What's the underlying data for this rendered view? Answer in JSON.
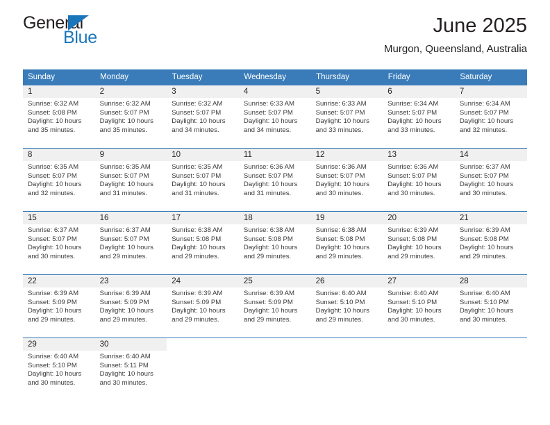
{
  "brand": {
    "name_part1": "General",
    "name_part2": "Blue",
    "accent_color": "#1b75bb"
  },
  "header": {
    "title": "June 2025",
    "subtitle": "Murgon, Queensland, Australia"
  },
  "calendar": {
    "header_bg": "#3a7cb9",
    "daynum_bg": "#f0f0f0",
    "weekday_headers": [
      "Sunday",
      "Monday",
      "Tuesday",
      "Wednesday",
      "Thursday",
      "Friday",
      "Saturday"
    ],
    "labels": {
      "sunrise": "Sunrise:",
      "sunset": "Sunset:",
      "daylight": "Daylight:"
    },
    "weeks": [
      [
        {
          "day": "1",
          "sunrise": "Sunrise: 6:32 AM",
          "sunset": "Sunset: 5:08 PM",
          "daylight_line1": "Daylight: 10 hours",
          "daylight_line2": "and 35 minutes."
        },
        {
          "day": "2",
          "sunrise": "Sunrise: 6:32 AM",
          "sunset": "Sunset: 5:07 PM",
          "daylight_line1": "Daylight: 10 hours",
          "daylight_line2": "and 35 minutes."
        },
        {
          "day": "3",
          "sunrise": "Sunrise: 6:32 AM",
          "sunset": "Sunset: 5:07 PM",
          "daylight_line1": "Daylight: 10 hours",
          "daylight_line2": "and 34 minutes."
        },
        {
          "day": "4",
          "sunrise": "Sunrise: 6:33 AM",
          "sunset": "Sunset: 5:07 PM",
          "daylight_line1": "Daylight: 10 hours",
          "daylight_line2": "and 34 minutes."
        },
        {
          "day": "5",
          "sunrise": "Sunrise: 6:33 AM",
          "sunset": "Sunset: 5:07 PM",
          "daylight_line1": "Daylight: 10 hours",
          "daylight_line2": "and 33 minutes."
        },
        {
          "day": "6",
          "sunrise": "Sunrise: 6:34 AM",
          "sunset": "Sunset: 5:07 PM",
          "daylight_line1": "Daylight: 10 hours",
          "daylight_line2": "and 33 minutes."
        },
        {
          "day": "7",
          "sunrise": "Sunrise: 6:34 AM",
          "sunset": "Sunset: 5:07 PM",
          "daylight_line1": "Daylight: 10 hours",
          "daylight_line2": "and 32 minutes."
        }
      ],
      [
        {
          "day": "8",
          "sunrise": "Sunrise: 6:35 AM",
          "sunset": "Sunset: 5:07 PM",
          "daylight_line1": "Daylight: 10 hours",
          "daylight_line2": "and 32 minutes."
        },
        {
          "day": "9",
          "sunrise": "Sunrise: 6:35 AM",
          "sunset": "Sunset: 5:07 PM",
          "daylight_line1": "Daylight: 10 hours",
          "daylight_line2": "and 31 minutes."
        },
        {
          "day": "10",
          "sunrise": "Sunrise: 6:35 AM",
          "sunset": "Sunset: 5:07 PM",
          "daylight_line1": "Daylight: 10 hours",
          "daylight_line2": "and 31 minutes."
        },
        {
          "day": "11",
          "sunrise": "Sunrise: 6:36 AM",
          "sunset": "Sunset: 5:07 PM",
          "daylight_line1": "Daylight: 10 hours",
          "daylight_line2": "and 31 minutes."
        },
        {
          "day": "12",
          "sunrise": "Sunrise: 6:36 AM",
          "sunset": "Sunset: 5:07 PM",
          "daylight_line1": "Daylight: 10 hours",
          "daylight_line2": "and 30 minutes."
        },
        {
          "day": "13",
          "sunrise": "Sunrise: 6:36 AM",
          "sunset": "Sunset: 5:07 PM",
          "daylight_line1": "Daylight: 10 hours",
          "daylight_line2": "and 30 minutes."
        },
        {
          "day": "14",
          "sunrise": "Sunrise: 6:37 AM",
          "sunset": "Sunset: 5:07 PM",
          "daylight_line1": "Daylight: 10 hours",
          "daylight_line2": "and 30 minutes."
        }
      ],
      [
        {
          "day": "15",
          "sunrise": "Sunrise: 6:37 AM",
          "sunset": "Sunset: 5:07 PM",
          "daylight_line1": "Daylight: 10 hours",
          "daylight_line2": "and 30 minutes."
        },
        {
          "day": "16",
          "sunrise": "Sunrise: 6:37 AM",
          "sunset": "Sunset: 5:07 PM",
          "daylight_line1": "Daylight: 10 hours",
          "daylight_line2": "and 29 minutes."
        },
        {
          "day": "17",
          "sunrise": "Sunrise: 6:38 AM",
          "sunset": "Sunset: 5:08 PM",
          "daylight_line1": "Daylight: 10 hours",
          "daylight_line2": "and 29 minutes."
        },
        {
          "day": "18",
          "sunrise": "Sunrise: 6:38 AM",
          "sunset": "Sunset: 5:08 PM",
          "daylight_line1": "Daylight: 10 hours",
          "daylight_line2": "and 29 minutes."
        },
        {
          "day": "19",
          "sunrise": "Sunrise: 6:38 AM",
          "sunset": "Sunset: 5:08 PM",
          "daylight_line1": "Daylight: 10 hours",
          "daylight_line2": "and 29 minutes."
        },
        {
          "day": "20",
          "sunrise": "Sunrise: 6:39 AM",
          "sunset": "Sunset: 5:08 PM",
          "daylight_line1": "Daylight: 10 hours",
          "daylight_line2": "and 29 minutes."
        },
        {
          "day": "21",
          "sunrise": "Sunrise: 6:39 AM",
          "sunset": "Sunset: 5:08 PM",
          "daylight_line1": "Daylight: 10 hours",
          "daylight_line2": "and 29 minutes."
        }
      ],
      [
        {
          "day": "22",
          "sunrise": "Sunrise: 6:39 AM",
          "sunset": "Sunset: 5:09 PM",
          "daylight_line1": "Daylight: 10 hours",
          "daylight_line2": "and 29 minutes."
        },
        {
          "day": "23",
          "sunrise": "Sunrise: 6:39 AM",
          "sunset": "Sunset: 5:09 PM",
          "daylight_line1": "Daylight: 10 hours",
          "daylight_line2": "and 29 minutes."
        },
        {
          "day": "24",
          "sunrise": "Sunrise: 6:39 AM",
          "sunset": "Sunset: 5:09 PM",
          "daylight_line1": "Daylight: 10 hours",
          "daylight_line2": "and 29 minutes."
        },
        {
          "day": "25",
          "sunrise": "Sunrise: 6:39 AM",
          "sunset": "Sunset: 5:09 PM",
          "daylight_line1": "Daylight: 10 hours",
          "daylight_line2": "and 29 minutes."
        },
        {
          "day": "26",
          "sunrise": "Sunrise: 6:40 AM",
          "sunset": "Sunset: 5:10 PM",
          "daylight_line1": "Daylight: 10 hours",
          "daylight_line2": "and 29 minutes."
        },
        {
          "day": "27",
          "sunrise": "Sunrise: 6:40 AM",
          "sunset": "Sunset: 5:10 PM",
          "daylight_line1": "Daylight: 10 hours",
          "daylight_line2": "and 30 minutes."
        },
        {
          "day": "28",
          "sunrise": "Sunrise: 6:40 AM",
          "sunset": "Sunset: 5:10 PM",
          "daylight_line1": "Daylight: 10 hours",
          "daylight_line2": "and 30 minutes."
        }
      ],
      [
        {
          "day": "29",
          "sunrise": "Sunrise: 6:40 AM",
          "sunset": "Sunset: 5:10 PM",
          "daylight_line1": "Daylight: 10 hours",
          "daylight_line2": "and 30 minutes."
        },
        {
          "day": "30",
          "sunrise": "Sunrise: 6:40 AM",
          "sunset": "Sunset: 5:11 PM",
          "daylight_line1": "Daylight: 10 hours",
          "daylight_line2": "and 30 minutes."
        },
        {
          "day": "",
          "sunrise": "",
          "sunset": "",
          "daylight_line1": "",
          "daylight_line2": ""
        },
        {
          "day": "",
          "sunrise": "",
          "sunset": "",
          "daylight_line1": "",
          "daylight_line2": ""
        },
        {
          "day": "",
          "sunrise": "",
          "sunset": "",
          "daylight_line1": "",
          "daylight_line2": ""
        },
        {
          "day": "",
          "sunrise": "",
          "sunset": "",
          "daylight_line1": "",
          "daylight_line2": ""
        },
        {
          "day": "",
          "sunrise": "",
          "sunset": "",
          "daylight_line1": "",
          "daylight_line2": ""
        }
      ]
    ]
  }
}
